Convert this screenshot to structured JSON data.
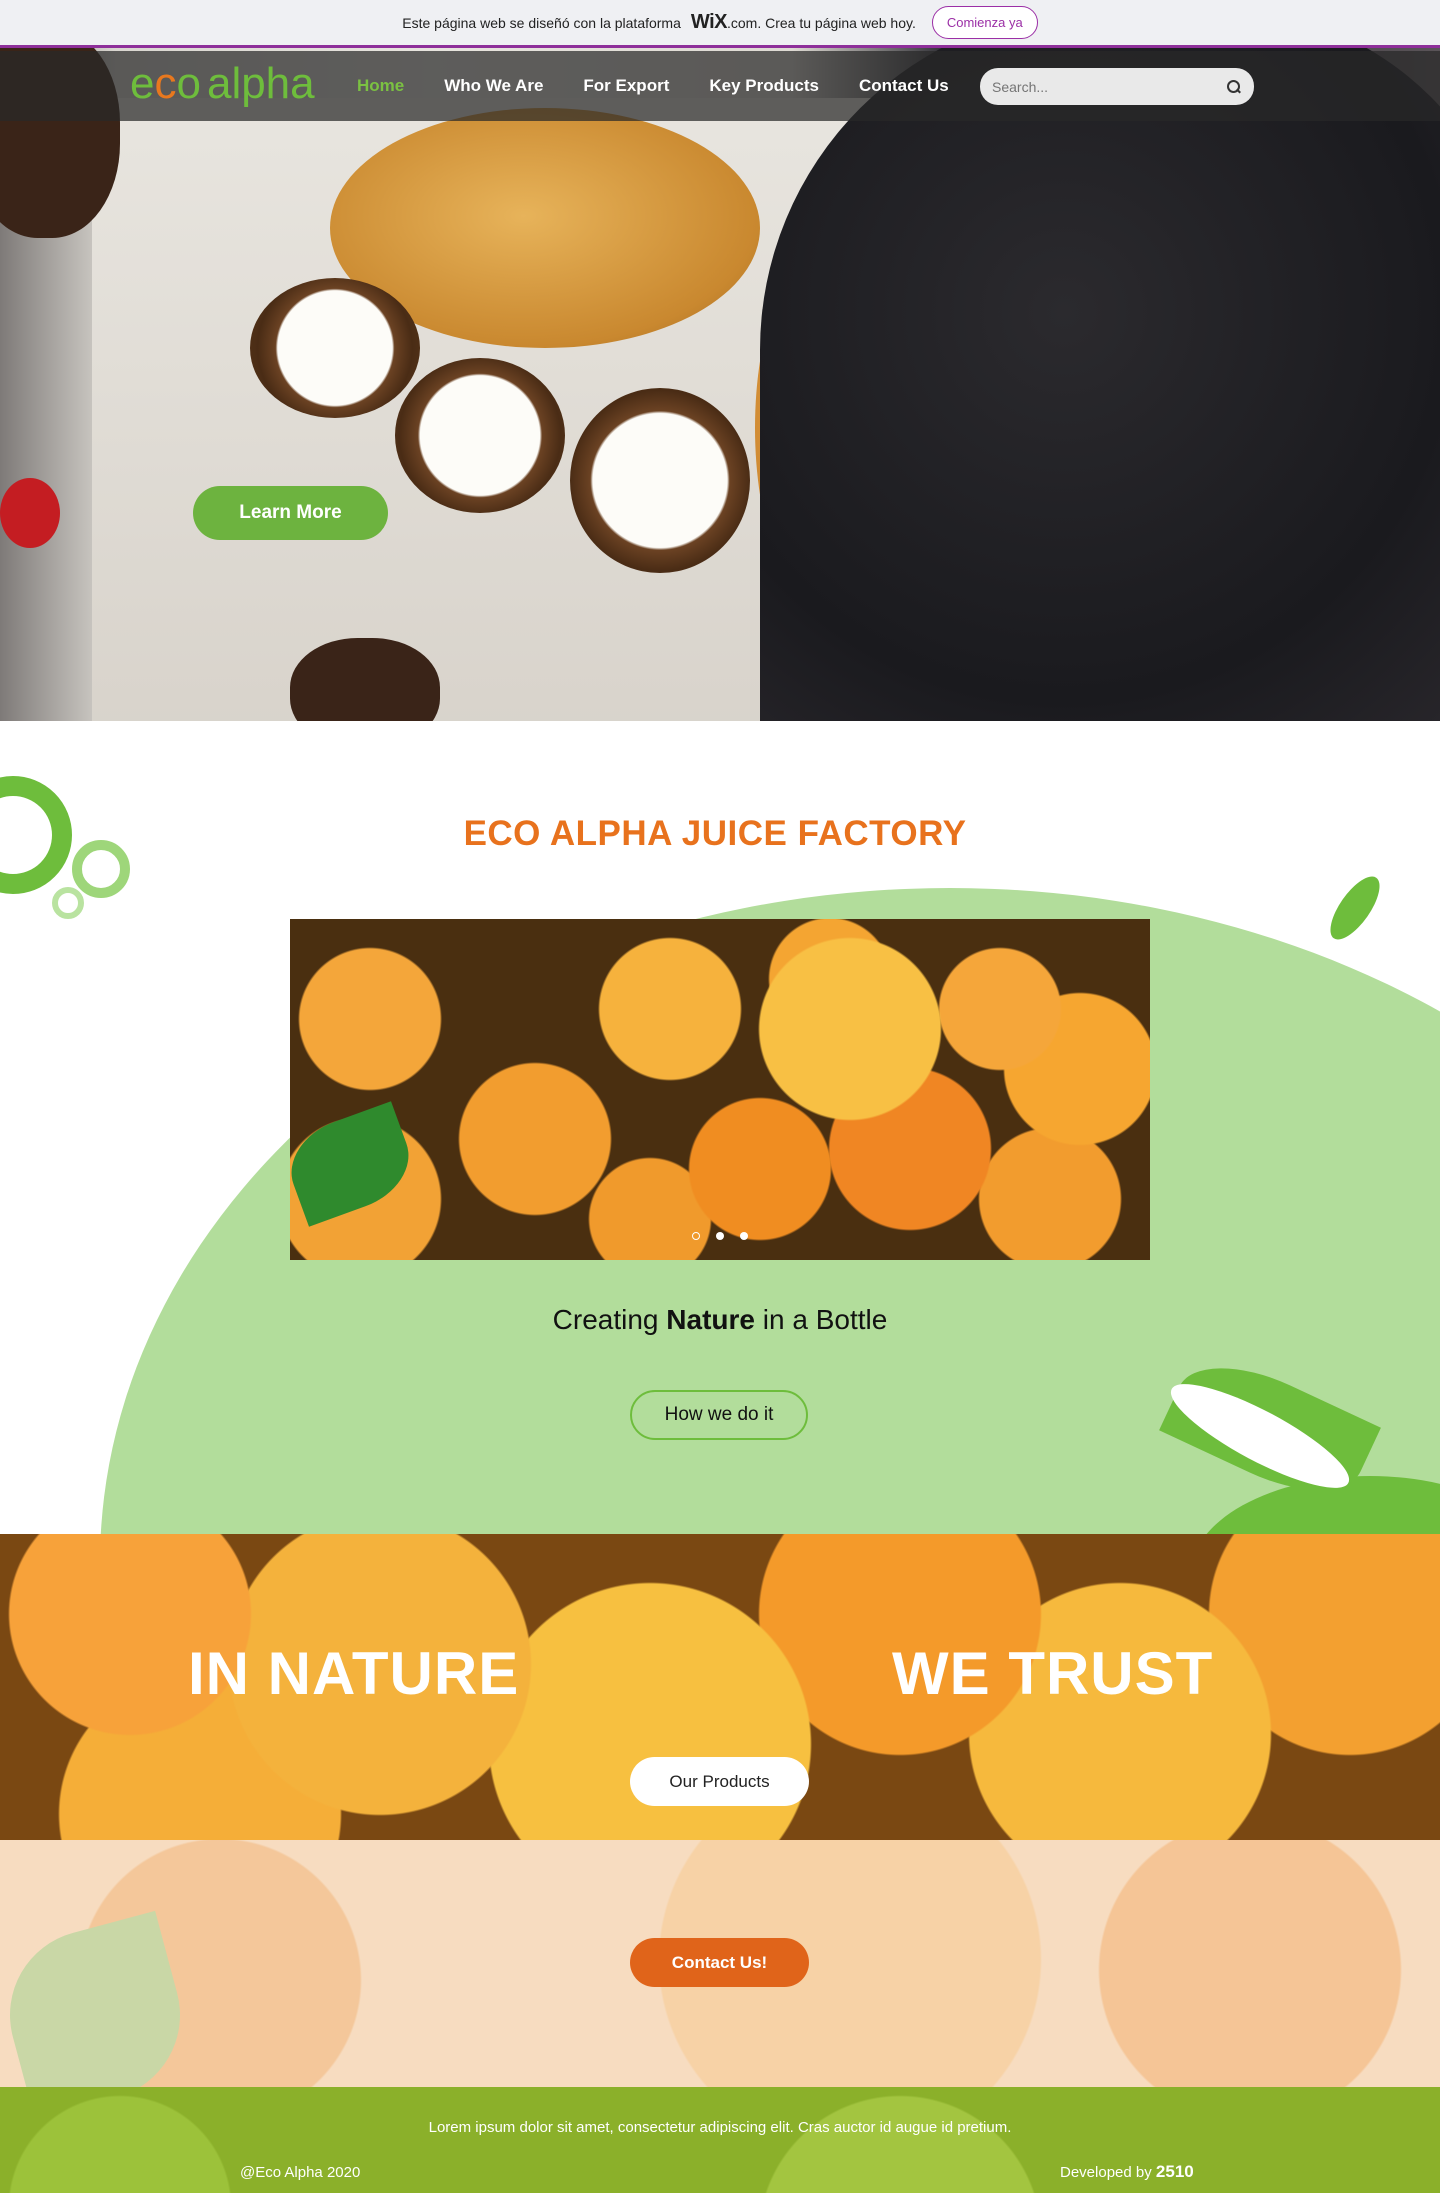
{
  "wix_banner": {
    "text_before": "Este página web se diseñó con la plataforma",
    "brand": "WiX",
    "text_after": ".com. Crea tu página web hoy.",
    "cta_label": "Comienza ya"
  },
  "header": {
    "logo": {
      "e": "e",
      "c": "c",
      "o": "o",
      "alpha": "alpha"
    },
    "nav": [
      {
        "label": "Home",
        "active": true
      },
      {
        "label": "Who We Are",
        "active": false
      },
      {
        "label": "For Export",
        "active": false
      },
      {
        "label": "Key Products",
        "active": false
      },
      {
        "label": "Contact Us",
        "active": false
      }
    ],
    "search": {
      "placeholder": "Search...",
      "icon": "search-icon"
    }
  },
  "hero": {
    "cta_label": "Learn More"
  },
  "factory": {
    "title": "ECO ALPHA JUICE FACTORY",
    "slider": {
      "slides": 3,
      "active_index": 0
    },
    "tagline": {
      "before": "Creating",
      "bold": "Nature",
      "after": "in a Bottle"
    },
    "cta_label": "How we do it"
  },
  "nature_band": {
    "phrase_left": "IN NATURE",
    "phrase_right": "WE TRUST",
    "cta_label": "Our Products"
  },
  "contact_band": {
    "cta_label": "Contact Us!"
  },
  "footer": {
    "lorem": "Lorem ipsum dolor sit amet, consectetur adipiscing elit. Cras auctor id augue id pretium.",
    "copyright": "@Eco Alpha 2020",
    "developed_prefix": "Developed by",
    "developed_brand": "2510"
  },
  "colors": {
    "brand_green": "#6ebd3c",
    "brand_orange": "#e8721d",
    "active_nav": "#7bc142",
    "wix_purple": "#9b2fa6",
    "contact_button": "#e0641a",
    "footer_bg": "#8bb02a"
  }
}
